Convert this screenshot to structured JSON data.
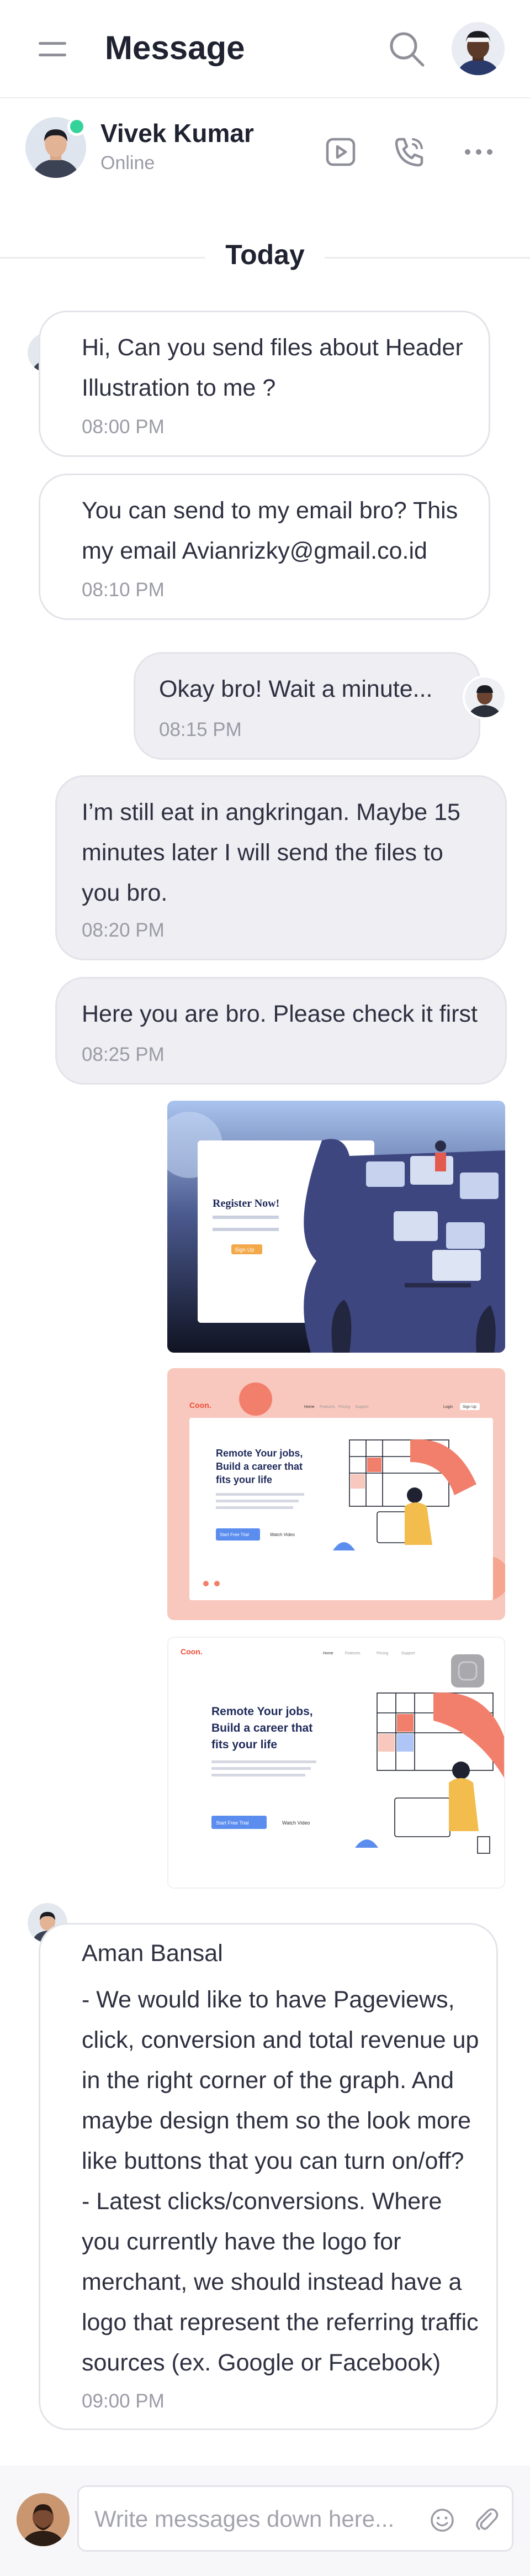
{
  "app_bar": {
    "title": "Message"
  },
  "chat_header": {
    "contact_name": "Vivek Kumar",
    "status": "Online"
  },
  "date_divider": "Today",
  "messages": [
    {
      "direction": "incoming",
      "lines": [
        "Hi, Can you send files about Header",
        "Illustration to me ?"
      ],
      "time": "08:00 PM"
    },
    {
      "direction": "incoming",
      "lines": [
        "You can send to my email bro? This",
        "my email Avianrizky@gmail.co.id"
      ],
      "time": "08:10 PM"
    },
    {
      "direction": "outgoing",
      "lines": [
        "Okay bro! Wait a minute..."
      ],
      "time": "08:15 PM"
    },
    {
      "direction": "outgoing",
      "lines": [
        "I’m still eat in angkringan. Maybe 15",
        "minutes later I will send the files to",
        "you bro."
      ],
      "time": "08:20 PM"
    },
    {
      "direction": "outgoing",
      "lines": [
        "Here you are bro. Please check it first"
      ],
      "time": "08:25 PM"
    },
    {
      "direction": "incoming",
      "sender": "Aman Bansal",
      "lines": [
        "- We would like to have Pageviews,",
        "click, conversion and total revenue up",
        "in the right corner of the graph. And",
        "maybe design them so the look more",
        "like buttons that you can turn on/off?",
        "- Latest clicks/conversions. Where",
        "you currently have the logo for",
        "merchant, we should instead have a",
        "logo that represent the referring traffic",
        "sources (ex. Google or Facebook)"
      ],
      "time": "09:00 PM"
    }
  ],
  "attachments": [
    {
      "kind": "image",
      "heading": "Register Now!",
      "button": "Sign Up"
    },
    {
      "kind": "image",
      "logo": "Coon.",
      "heading_lines": [
        "Remote Your jobs,",
        "Build a career that",
        "fits your life"
      ],
      "primary_button": "Start Free Trial",
      "secondary_button": "Watch Video",
      "nav": [
        "Home",
        "Features",
        "Pricing",
        "Support"
      ],
      "login": "Login",
      "signup": "Sign Up"
    },
    {
      "kind": "image",
      "logo": "Coon.",
      "heading_lines": [
        "Remote Your jobs,",
        "Build a career that",
        "fits your life"
      ],
      "primary_button": "Start Free Trial",
      "secondary_button": "Watch Video",
      "nav": [
        "Home",
        "Features",
        "Pricing",
        "Support"
      ]
    }
  ],
  "composer": {
    "placeholder": "Write messages down here..."
  },
  "icons": {
    "menu": "hamburger-icon",
    "search": "search-icon",
    "video": "video-call-icon",
    "call": "phone-call-icon",
    "more": "more-horizontal-icon",
    "emoji": "emoji-icon",
    "attach": "paperclip-icon"
  },
  "colors": {
    "online": "#34D39A",
    "primary_text": "#1F2230",
    "muted_text": "#9A9BA5",
    "bubble_gray": "#EEEEF3",
    "accent_blue": "#5B8DEF",
    "accent_salmon": "#F5A99B"
  }
}
